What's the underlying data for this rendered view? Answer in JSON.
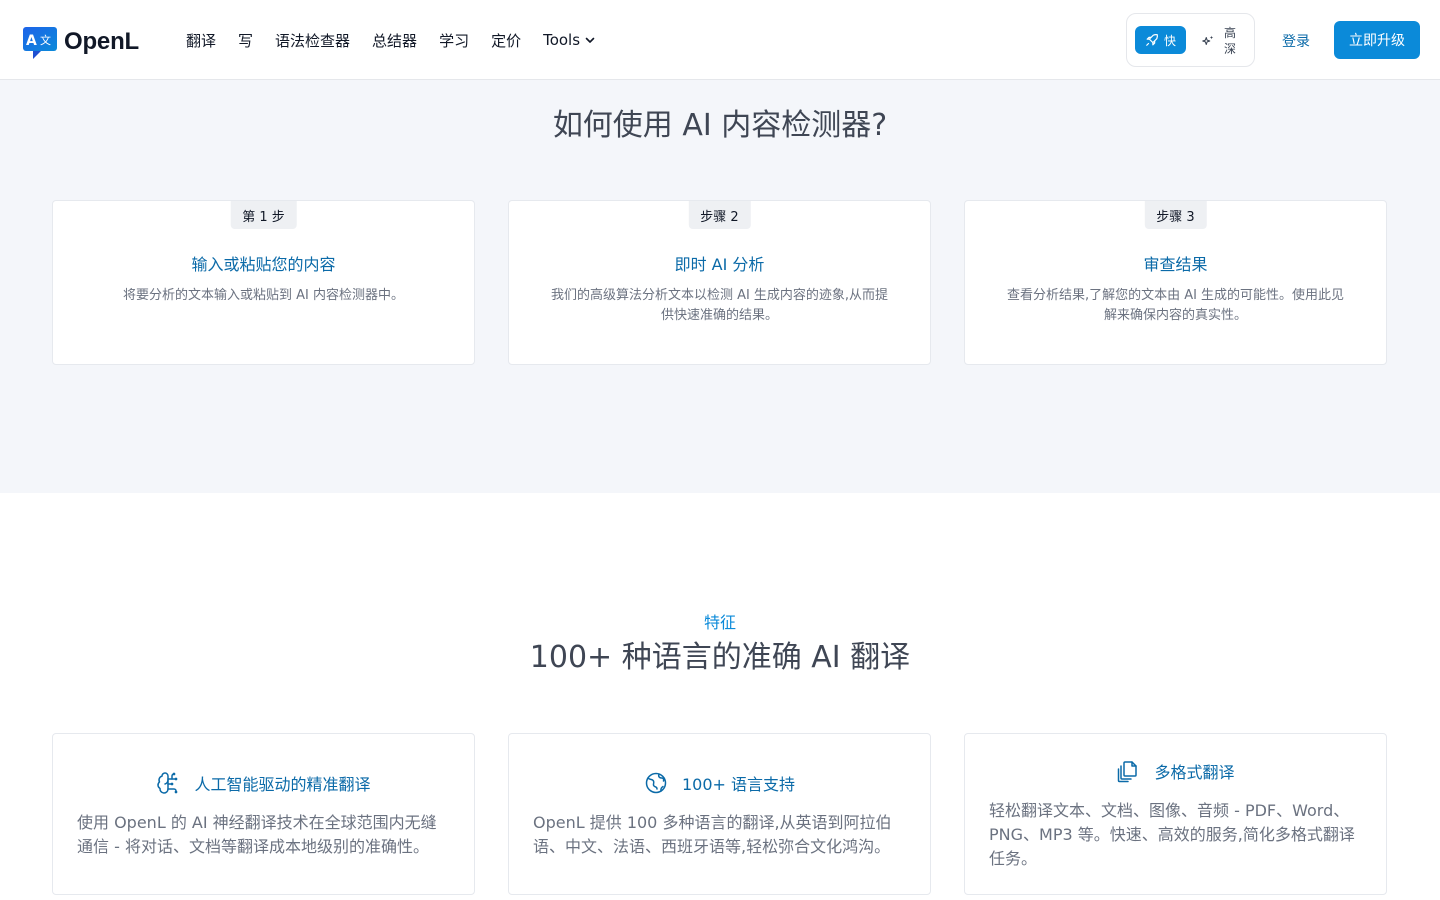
{
  "header": {
    "logo_text": "OpenL",
    "nav": [
      "翻译",
      "写",
      "语法检查器",
      "总结器",
      "学习",
      "定价"
    ],
    "tools_label": "Tools",
    "mode_fast": "快",
    "mode_deep": "高深",
    "mode_deep_chars": [
      "高",
      "深"
    ],
    "login": "登录",
    "upgrade": "立即升级"
  },
  "how": {
    "title": "如何使用 AI 内容检测器?",
    "steps": [
      {
        "badge": "第 1 步",
        "title": "输入或粘贴您的内容",
        "desc": "将要分析的文本输入或粘贴到 AI 内容检测器中。"
      },
      {
        "badge": "步骤 2",
        "title": "即时 AI 分析",
        "desc": "我们的高级算法分析文本以检测 AI 生成内容的迹象,从而提供快速准确的结果。"
      },
      {
        "badge": "步骤 3",
        "title": "审查结果",
        "desc": "查看分析结果,了解您的文本由 AI 生成的可能性。使用此见解来确保内容的真实性。"
      }
    ]
  },
  "features": {
    "eyebrow": "特征",
    "title": "100+ 种语言的准确 AI 翻译",
    "items": [
      {
        "icon": "brain-circuit-icon",
        "title": "人工智能驱动的精准翻译",
        "desc": "使用 OpenL 的 AI 神经翻译技术在全球范围内无缝通信 - 将对话、文档等翻译成本地级别的准确性。"
      },
      {
        "icon": "globe-icon",
        "title": "100+ 语言支持",
        "desc": "OpenL 提供 100 多种语言的翻译,从英语到阿拉伯语、中文、法语、西班牙语等,轻松弥合文化鸿沟。"
      },
      {
        "icon": "files-icon",
        "title": "多格式翻译",
        "desc": "轻松翻译文本、文档、图像、音频 - PDF、Word、PNG、MP3 等。快速、高效的服务,简化多格式翻译任务。"
      }
    ]
  },
  "colors": {
    "accent": "#0b8ad9",
    "link": "#0b6aa8",
    "section_bg": "#f4f6fa"
  }
}
